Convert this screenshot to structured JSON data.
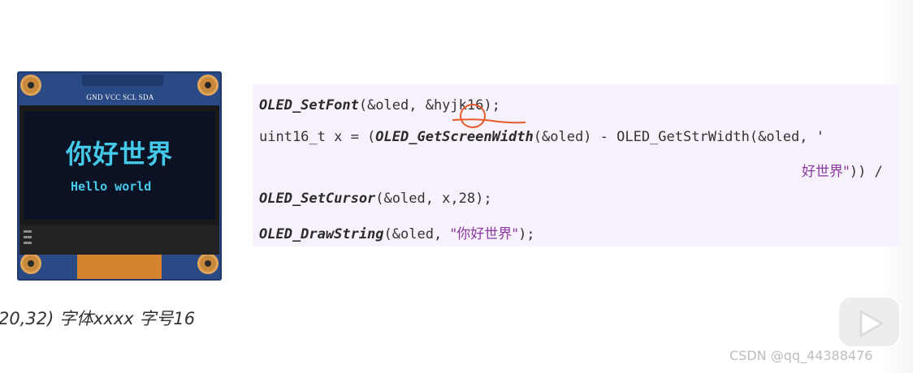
{
  "oled": {
    "pin_labels": "GND VCC SCL SDA",
    "screen_text_cn": "你好世界",
    "screen_text_en": "Hello world"
  },
  "code": {
    "line1_fn": "OLED_SetFont",
    "line1_args": "(&oled, &hyjk16);",
    "line2_prefix": "uint16_t x = (",
    "line2_fn": "OLED_GetScreenWidth",
    "line2_rest": "(&oled) - OLED_GetStrWidth(&oled, '",
    "line3_str": "好世界\"",
    "line3_rest": ")) /",
    "line4_fn": "OLED_SetCursor",
    "line4_args": "(&oled, x,28);",
    "line5_fn": "OLED_DrawString",
    "line5_args_a": "(&oled, ",
    "line5_str": "\"你好世界\"",
    "line5_args_b": ");"
  },
  "caption": "20,32) 字体xxxx 字号16",
  "watermark": "CSDN @qq_44388476",
  "colors": {
    "code_background": "#f7f1fb",
    "string_color": "#8a3aa0",
    "annotation_red": "#e85a2a",
    "oled_text": "#45c9e8",
    "pcb_blue": "#2a4a86"
  },
  "icons": {
    "play": "bilibili-play-icon"
  }
}
